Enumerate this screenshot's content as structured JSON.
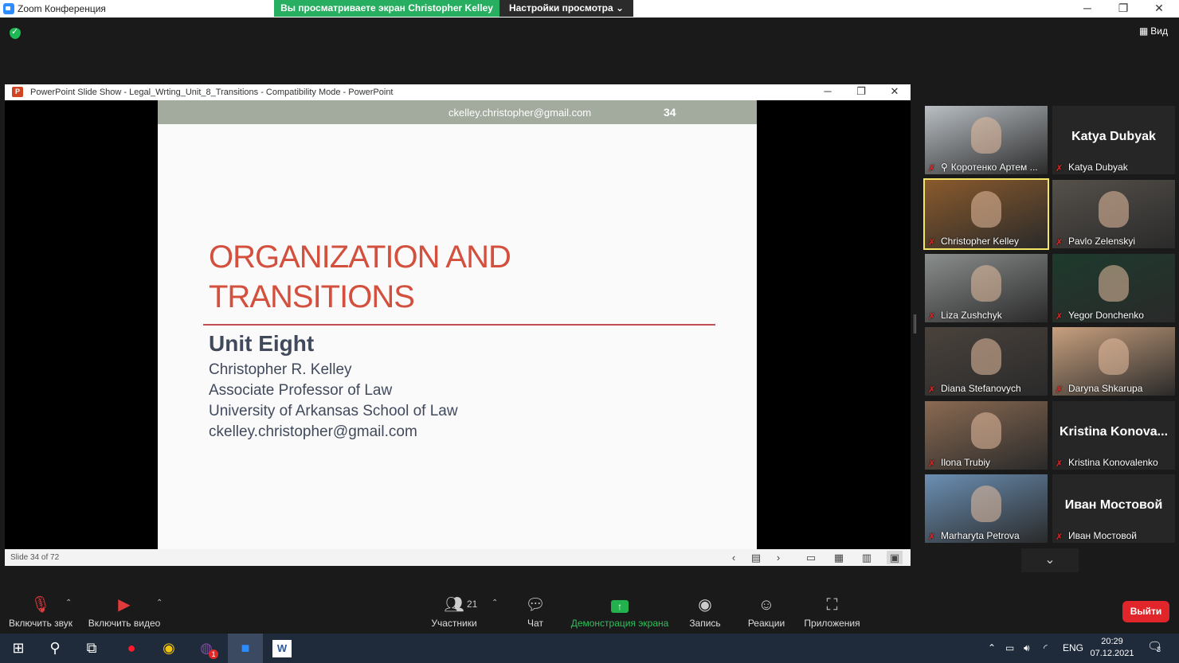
{
  "window": {
    "title": "Zoom Конференция"
  },
  "share_banner": {
    "viewing_text": "Вы просматриваете экран Christopher Kelley",
    "view_settings_label": "Настройки просмотра"
  },
  "view_button": {
    "label": "Вид"
  },
  "ppt": {
    "title": "PowerPoint Slide Show  -  Legal_Wrting_Unit_8_Transitions  -  Compatibility Mode - PowerPoint",
    "status": "Slide 34 of 72"
  },
  "slide": {
    "header_email": "ckelley.christopher@gmail.com",
    "number": "34",
    "title_line1": "ORGANIZATION AND",
    "title_line2": "TRANSITIONS",
    "unit": "Unit Eight",
    "author": "Christopher R. Kelley",
    "position": "Associate Professor of Law",
    "school": "University of Arkansas School of Law",
    "email": "ckelley.christopher@gmail.com"
  },
  "participants_gallery": [
    {
      "name": "Коротенко Артем ...",
      "video": true,
      "pinned": true,
      "bg": "#b9bfc4"
    },
    {
      "name": "Katya Dubyak",
      "video": false,
      "big_name": "Katya Dubyak"
    },
    {
      "name": "Christopher Kelley",
      "video": true,
      "active_speaker": true,
      "bg": "#8a5a2c"
    },
    {
      "name": "Pavlo Zelenskyi",
      "video": true,
      "bg": "#55504a"
    },
    {
      "name": "Liza Zushchyk",
      "video": true,
      "bg": "#8a8e8c"
    },
    {
      "name": "Yegor Donchenko",
      "video": true,
      "bg": "#1d3a2c"
    },
    {
      "name": "Diana Stefanovych",
      "video": true,
      "bg": "#4a423c"
    },
    {
      "name": "Daryna Shkarupa",
      "video": true,
      "bg": "#c8a07e"
    },
    {
      "name": "Ilona Trubiy",
      "video": true,
      "bg": "#8a6a52"
    },
    {
      "name": "Kristina Konovalenko",
      "video": false,
      "big_name": "Kristina  Konova..."
    },
    {
      "name": "Marharyta Petrova",
      "video": true,
      "bg": "#6b8fb3"
    },
    {
      "name": "Иван Мостовой",
      "video": false,
      "big_name": "Иван Мостовой"
    }
  ],
  "toolbar": {
    "audio_label": "Включить звук",
    "video_label": "Включить видео",
    "participants_label": "Участники",
    "participants_count": "21",
    "chat_label": "Чат",
    "share_label": "Демонстрация экрана",
    "record_label": "Запись",
    "reactions_label": "Реакции",
    "apps_label": "Приложения",
    "leave_label": "Выйти"
  },
  "taskbar": {
    "lang": "ENG",
    "time": "20:29",
    "date": "07.12.2021",
    "notifications": "3",
    "viber_badge": "1"
  },
  "colors": {
    "accent_green": "#27ae60",
    "leave_red": "#e0262a",
    "title_red": "#d4503e",
    "active_speaker": "#f4e566"
  }
}
